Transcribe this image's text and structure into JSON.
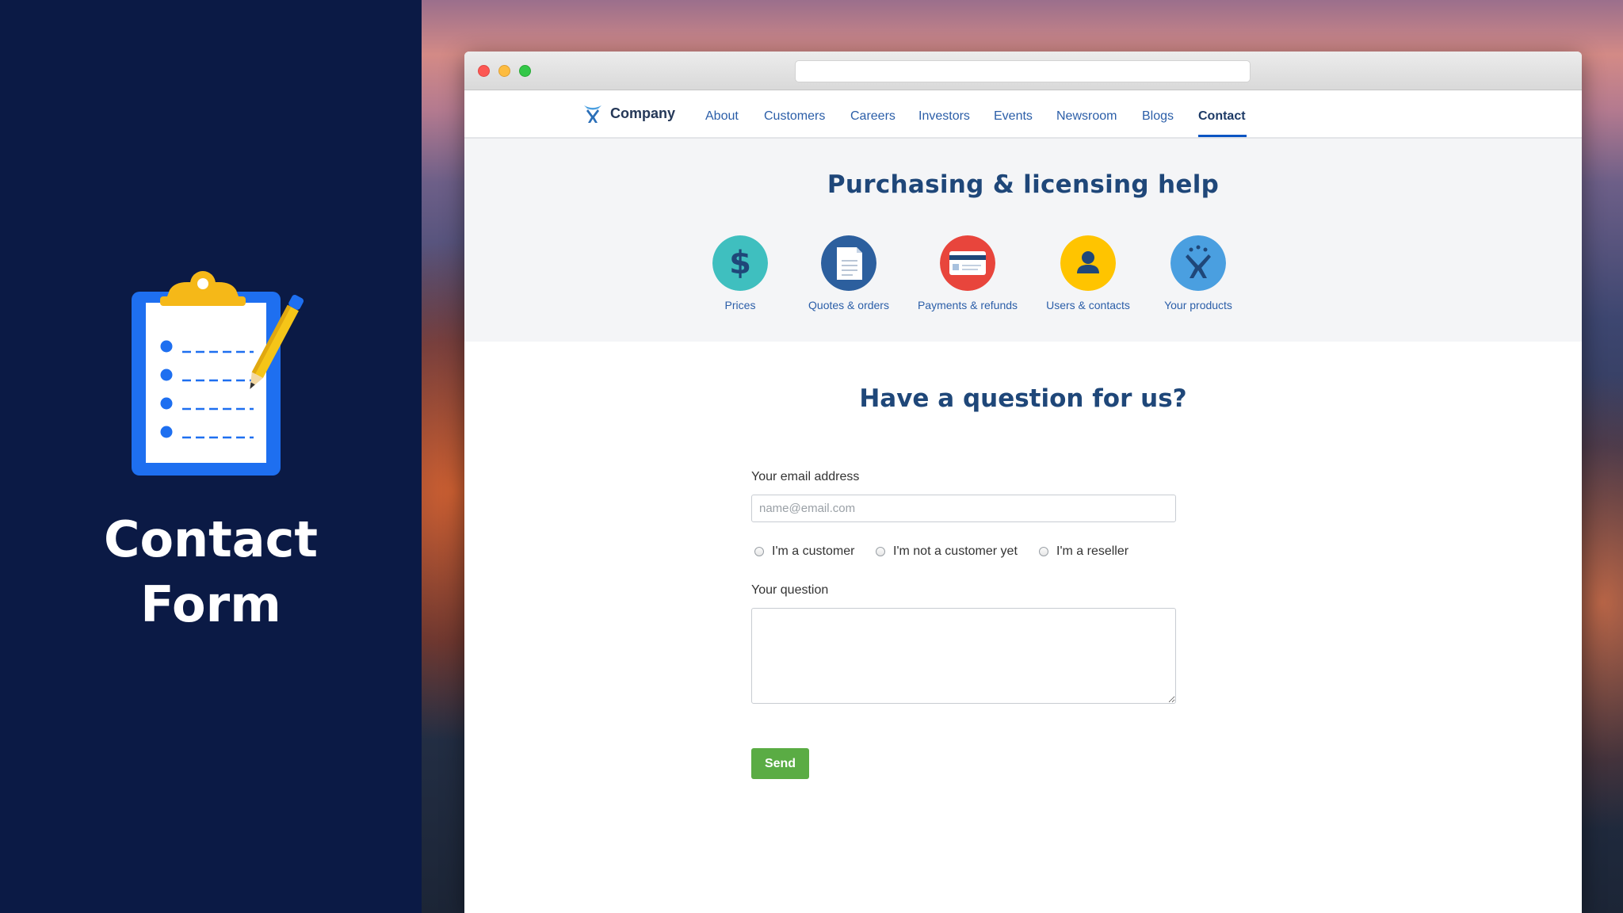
{
  "left_panel": {
    "title_line1": "Contact",
    "title_line2": "Form",
    "illustration_icon": "clipboard-checklist-pencil-icon"
  },
  "browser": {
    "address_bar_value": ""
  },
  "nav": {
    "logo_text": "Company",
    "logo_icon": "company-logo-icon",
    "items": [
      "About",
      "Customers",
      "Careers",
      "Investors",
      "Events",
      "Newsroom",
      "Blogs",
      "Contact"
    ],
    "active_item": "Contact"
  },
  "help": {
    "title": "Purchasing & licensing help",
    "items": [
      {
        "label": "Prices",
        "icon": "dollar-icon",
        "color": "#3fbfbf"
      },
      {
        "label": "Quotes & orders",
        "icon": "document-icon",
        "color": "#2c5f9e"
      },
      {
        "label": "Payments & refunds",
        "icon": "credit-card-icon",
        "color": "#e8453c"
      },
      {
        "label": "Users & contacts",
        "icon": "user-icon",
        "color": "#ffc400"
      },
      {
        "label": "Your products",
        "icon": "product-logo-icon",
        "color": "#4a9fe0"
      }
    ]
  },
  "form": {
    "title": "Have a question for us?",
    "email_label": "Your email address",
    "email_placeholder": "name@email.com",
    "email_value": "",
    "radio_options": [
      "I'm a customer",
      "I'm not a customer yet",
      "I'm a reseller"
    ],
    "question_label": "Your question",
    "question_value": "",
    "send_label": "Send",
    "send_color": "#5aac44"
  },
  "colors": {
    "panel_bg": "#0b1a45",
    "heading": "#1f4779",
    "link": "#2b5ea8"
  }
}
